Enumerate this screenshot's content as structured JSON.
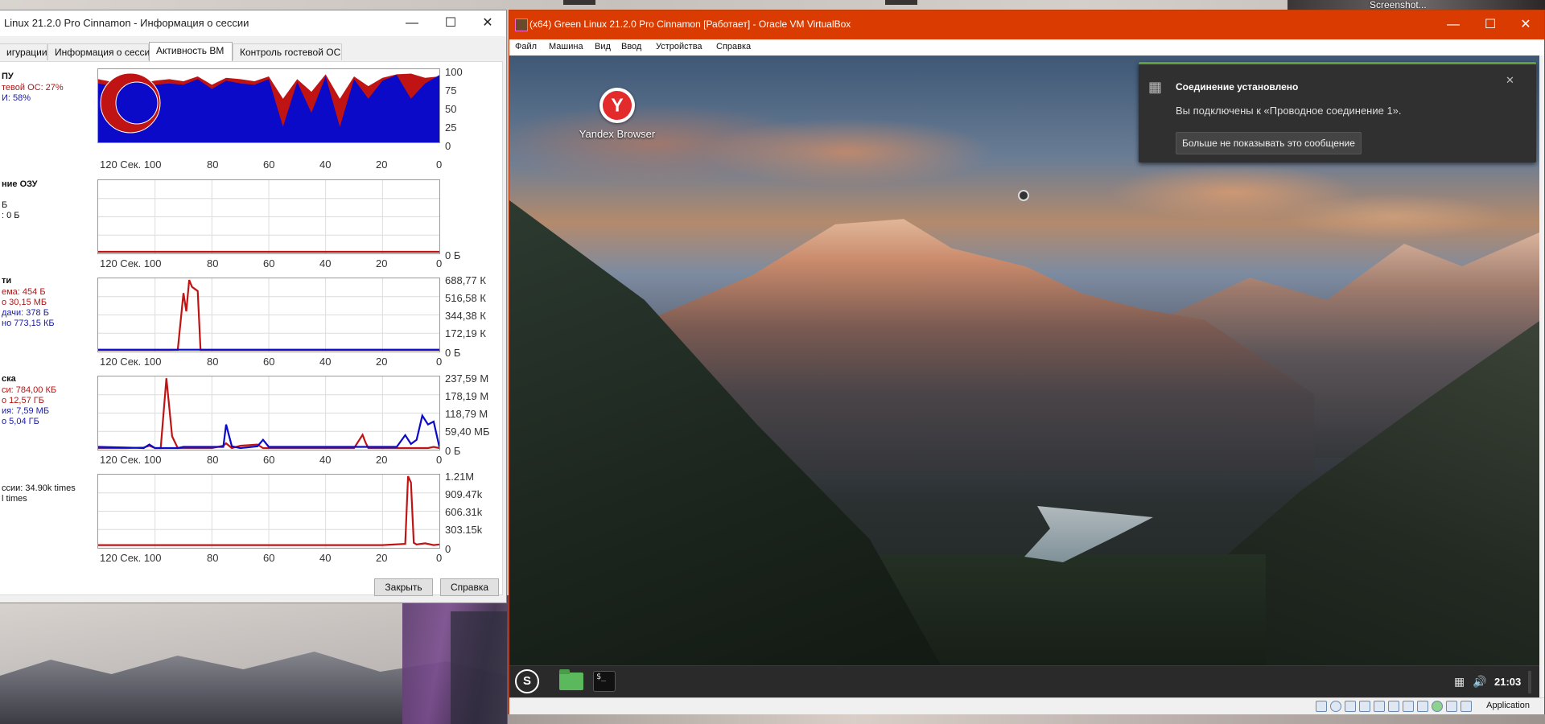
{
  "host": {
    "screenshot_label": "Screenshot..."
  },
  "session_window": {
    "title": "Linux 21.2.0 Pro Cinnamon - Информация о сессии",
    "tabs": [
      {
        "label": "игурации"
      },
      {
        "label": "Информация о сессии"
      },
      {
        "label": "Активность ВМ",
        "active": true
      },
      {
        "label": "Контроль гостевой ОС"
      }
    ],
    "cpu": {
      "header": "ПУ",
      "guest_line": "тевой ОС: 27%",
      "vmm_line": "И: 58%",
      "scale": [
        "100",
        "75",
        "50",
        "25",
        "0"
      ]
    },
    "ram": {
      "header": "ние ОЗУ",
      "line1": "Б",
      "line2": ": 0 Б",
      "scale": [
        "0 Б"
      ]
    },
    "network": {
      "header": "ти",
      "rx_rate": "ема: 454 Б",
      "rx_total": "о 30,15 МБ",
      "tx_rate": "дачи: 378 Б",
      "tx_total": "но 773,15 КБ",
      "scale": [
        "688,77 К",
        "516,58 К",
        "344,38 К",
        "172,19 К",
        "0 Б"
      ]
    },
    "disk": {
      "header": "ска",
      "read_rate": "си: 784,00 КБ",
      "read_total": "о 12,57 ГБ",
      "write_rate": "ия: 7,59 МБ",
      "write_total": "о 5,04 ГБ",
      "scale": [
        "237,59 М",
        "178,19 М",
        "118,79 М",
        "59,40 МБ",
        "0 Б"
      ]
    },
    "vmexits": {
      "line1": "ссии: 34.90k times",
      "line2": "l times",
      "scale": [
        "1.21M",
        "909.47k",
        "606.31k",
        "303.15k",
        "0"
      ]
    },
    "x_axis": [
      "120 Сек. 100",
      "80",
      "60",
      "40",
      "20",
      "0"
    ],
    "buttons": {
      "close": "Закрыть",
      "help": "Справка"
    }
  },
  "vbox_window": {
    "title": "(x64) Green Linux 21.2.0 Pro Cinnamon [Работает] - Oracle VM VirtualBox",
    "menu": [
      "Файл",
      "Машина",
      "Вид",
      "Ввод",
      "Устройства",
      "Справка"
    ],
    "host_key": "Application"
  },
  "guest": {
    "desktop_icon_label": "Yandex Browser",
    "notification": {
      "title": "Соединение установлено",
      "body": "Вы подключены к «Проводное соединение 1».",
      "action": "Больше не показывать это сообщение"
    },
    "clock": "21:03",
    "terminal_glyph": "$_"
  },
  "colors": {
    "vbox_titlebar": "#da3b01",
    "series_red": "#c01414",
    "series_blue": "#0a0ac8",
    "notif_accent": "#5e9e3b"
  },
  "chart_data": [
    {
      "type": "area",
      "name": "cpu",
      "x": [
        120,
        115,
        110,
        105,
        100,
        95,
        90,
        85,
        80,
        75,
        70,
        65,
        60,
        55,
        50,
        45,
        40,
        35,
        30,
        25,
        20,
        15,
        10,
        5,
        0
      ],
      "series": [
        {
          "values": [
            88,
            84,
            78,
            82,
            86,
            88,
            85,
            92,
            80,
            90,
            88,
            85,
            92,
            60,
            88,
            70,
            95,
            60,
            92,
            78,
            90,
            95,
            96,
            90,
            92
          ]
        },
        {
          "values": [
            82,
            78,
            70,
            76,
            80,
            82,
            80,
            88,
            74,
            86,
            82,
            80,
            88,
            20,
            84,
            40,
            92,
            20,
            88,
            60,
            86,
            94,
            60,
            82,
            94
          ]
        }
      ],
      "ylim": [
        0,
        100
      ]
    },
    {
      "type": "line",
      "name": "ram",
      "x": [
        120,
        0
      ],
      "series": [
        {
          "values": [
            0,
            0
          ]
        }
      ]
    },
    {
      "type": "line",
      "name": "network",
      "x": [
        120,
        100,
        95,
        92,
        90,
        89,
        88,
        87,
        86,
        85,
        84,
        82,
        80,
        60,
        40,
        20,
        0
      ],
      "series": [
        {
          "values": [
            0,
            0,
            0,
            1,
            560,
            380,
            688,
            620,
            600,
            580,
            0,
            0,
            0,
            0,
            0,
            0,
            0
          ]
        },
        {
          "values": [
            2,
            2,
            2,
            2,
            2,
            2,
            2,
            2,
            2,
            2,
            2,
            2,
            2,
            2,
            2,
            2,
            2
          ]
        }
      ],
      "ylim": [
        0,
        688.77
      ]
    },
    {
      "type": "line",
      "name": "disk",
      "x": [
        120,
        110,
        104,
        102,
        100,
        98,
        96,
        94,
        92,
        90,
        85,
        80,
        76,
        75,
        73,
        70,
        64,
        62,
        60,
        45,
        30,
        27,
        26,
        25,
        15,
        12,
        10,
        8,
        6,
        4,
        2,
        0
      ],
      "series": [
        {
          "values": [
            0,
            0,
            2,
            8,
            0,
            0,
            237,
            40,
            0,
            0,
            0,
            0,
            8,
            16,
            0,
            8,
            12,
            0,
            0,
            0,
            0,
            45,
            20,
            0,
            0,
            0,
            0,
            0,
            0,
            0,
            4,
            0
          ]
        },
        {
          "values": [
            4,
            2,
            0,
            12,
            0,
            0,
            0,
            0,
            0,
            4,
            4,
            4,
            4,
            80,
            6,
            0,
            6,
            28,
            4,
            4,
            4,
            4,
            4,
            4,
            4,
            44,
            14,
            28,
            110,
            80,
            90,
            4
          ]
        }
      ],
      "ylim": [
        0,
        237.59
      ]
    },
    {
      "type": "line",
      "name": "vmexits",
      "x": [
        120,
        100,
        80,
        60,
        40,
        20,
        12,
        11,
        10,
        9,
        8,
        5,
        2,
        0
      ],
      "series": [
        {
          "values": [
            20,
            20,
            20,
            20,
            20,
            20,
            40,
            1210,
            1100,
            60,
            30,
            50,
            20,
            30
          ]
        }
      ],
      "ylim": [
        0,
        1210
      ]
    }
  ]
}
